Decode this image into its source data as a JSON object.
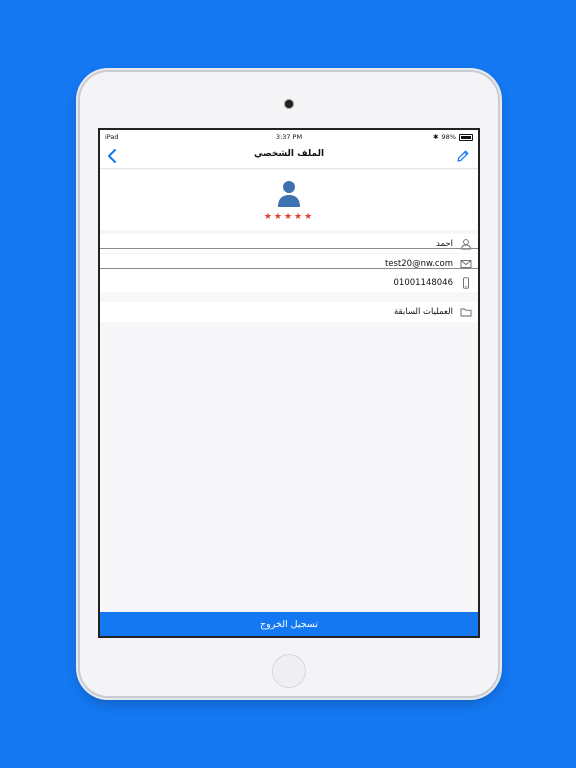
{
  "status_bar": {
    "device": "iPad",
    "time": "3:37 PM",
    "battery": "98%"
  },
  "nav": {
    "title": "الملف الشخصي",
    "back_icon": "chevron-left-icon",
    "edit_icon": "pencil-icon"
  },
  "profile": {
    "rating": "★★★★★",
    "rating_value": 5,
    "avatar_icon": "user-avatar-icon"
  },
  "fields": {
    "name": "احمد",
    "email": "test20@nw.com",
    "phone": "01001148046"
  },
  "menu": {
    "previous_operations": "العمليات السابقة"
  },
  "logout": {
    "label": "تسجيل الخروج"
  },
  "colors": {
    "accent": "#1478f2",
    "star": "#e43c2f",
    "avatar": "#3d72b0"
  }
}
